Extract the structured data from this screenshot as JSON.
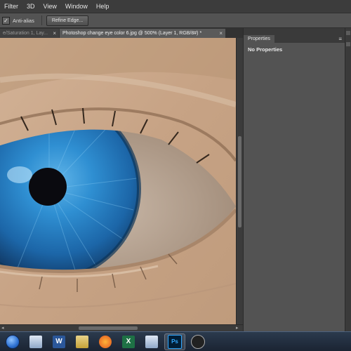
{
  "menu": {
    "items": [
      "Filter",
      "3D",
      "View",
      "Window",
      "Help"
    ]
  },
  "options_bar": {
    "antialias_checked": true,
    "check_mark": "✓",
    "antialias_label": "Anti-alias",
    "refine_edge_label": "Refine Edge..."
  },
  "tabs": {
    "inactive_label": "e/Saturation 1, Lay...",
    "active_label": "Photoshop change eye color 6.jpg @ 500% (Layer 1, RGB/8#) *",
    "close_glyph": "×"
  },
  "properties_panel": {
    "tab_label": "Properties",
    "menu_glyph": "≡",
    "empty_message": "No Properties"
  },
  "taskbar": {
    "items": [
      {
        "icon": "start-orb-icon"
      },
      {
        "icon": "windows-explorer-icon"
      },
      {
        "icon": "word-icon",
        "text": "W"
      },
      {
        "icon": "file-icon"
      },
      {
        "icon": "firefox-icon"
      },
      {
        "icon": "excel-icon",
        "text": "X"
      },
      {
        "icon": "folder-icon"
      },
      {
        "icon": "photoshop-icon",
        "text": "Ps",
        "active": true
      },
      {
        "icon": "obs-icon"
      }
    ]
  },
  "colors": {
    "iris": "#2a7ec8",
    "skin": "#c9a688",
    "ui_dark": "#535353"
  }
}
